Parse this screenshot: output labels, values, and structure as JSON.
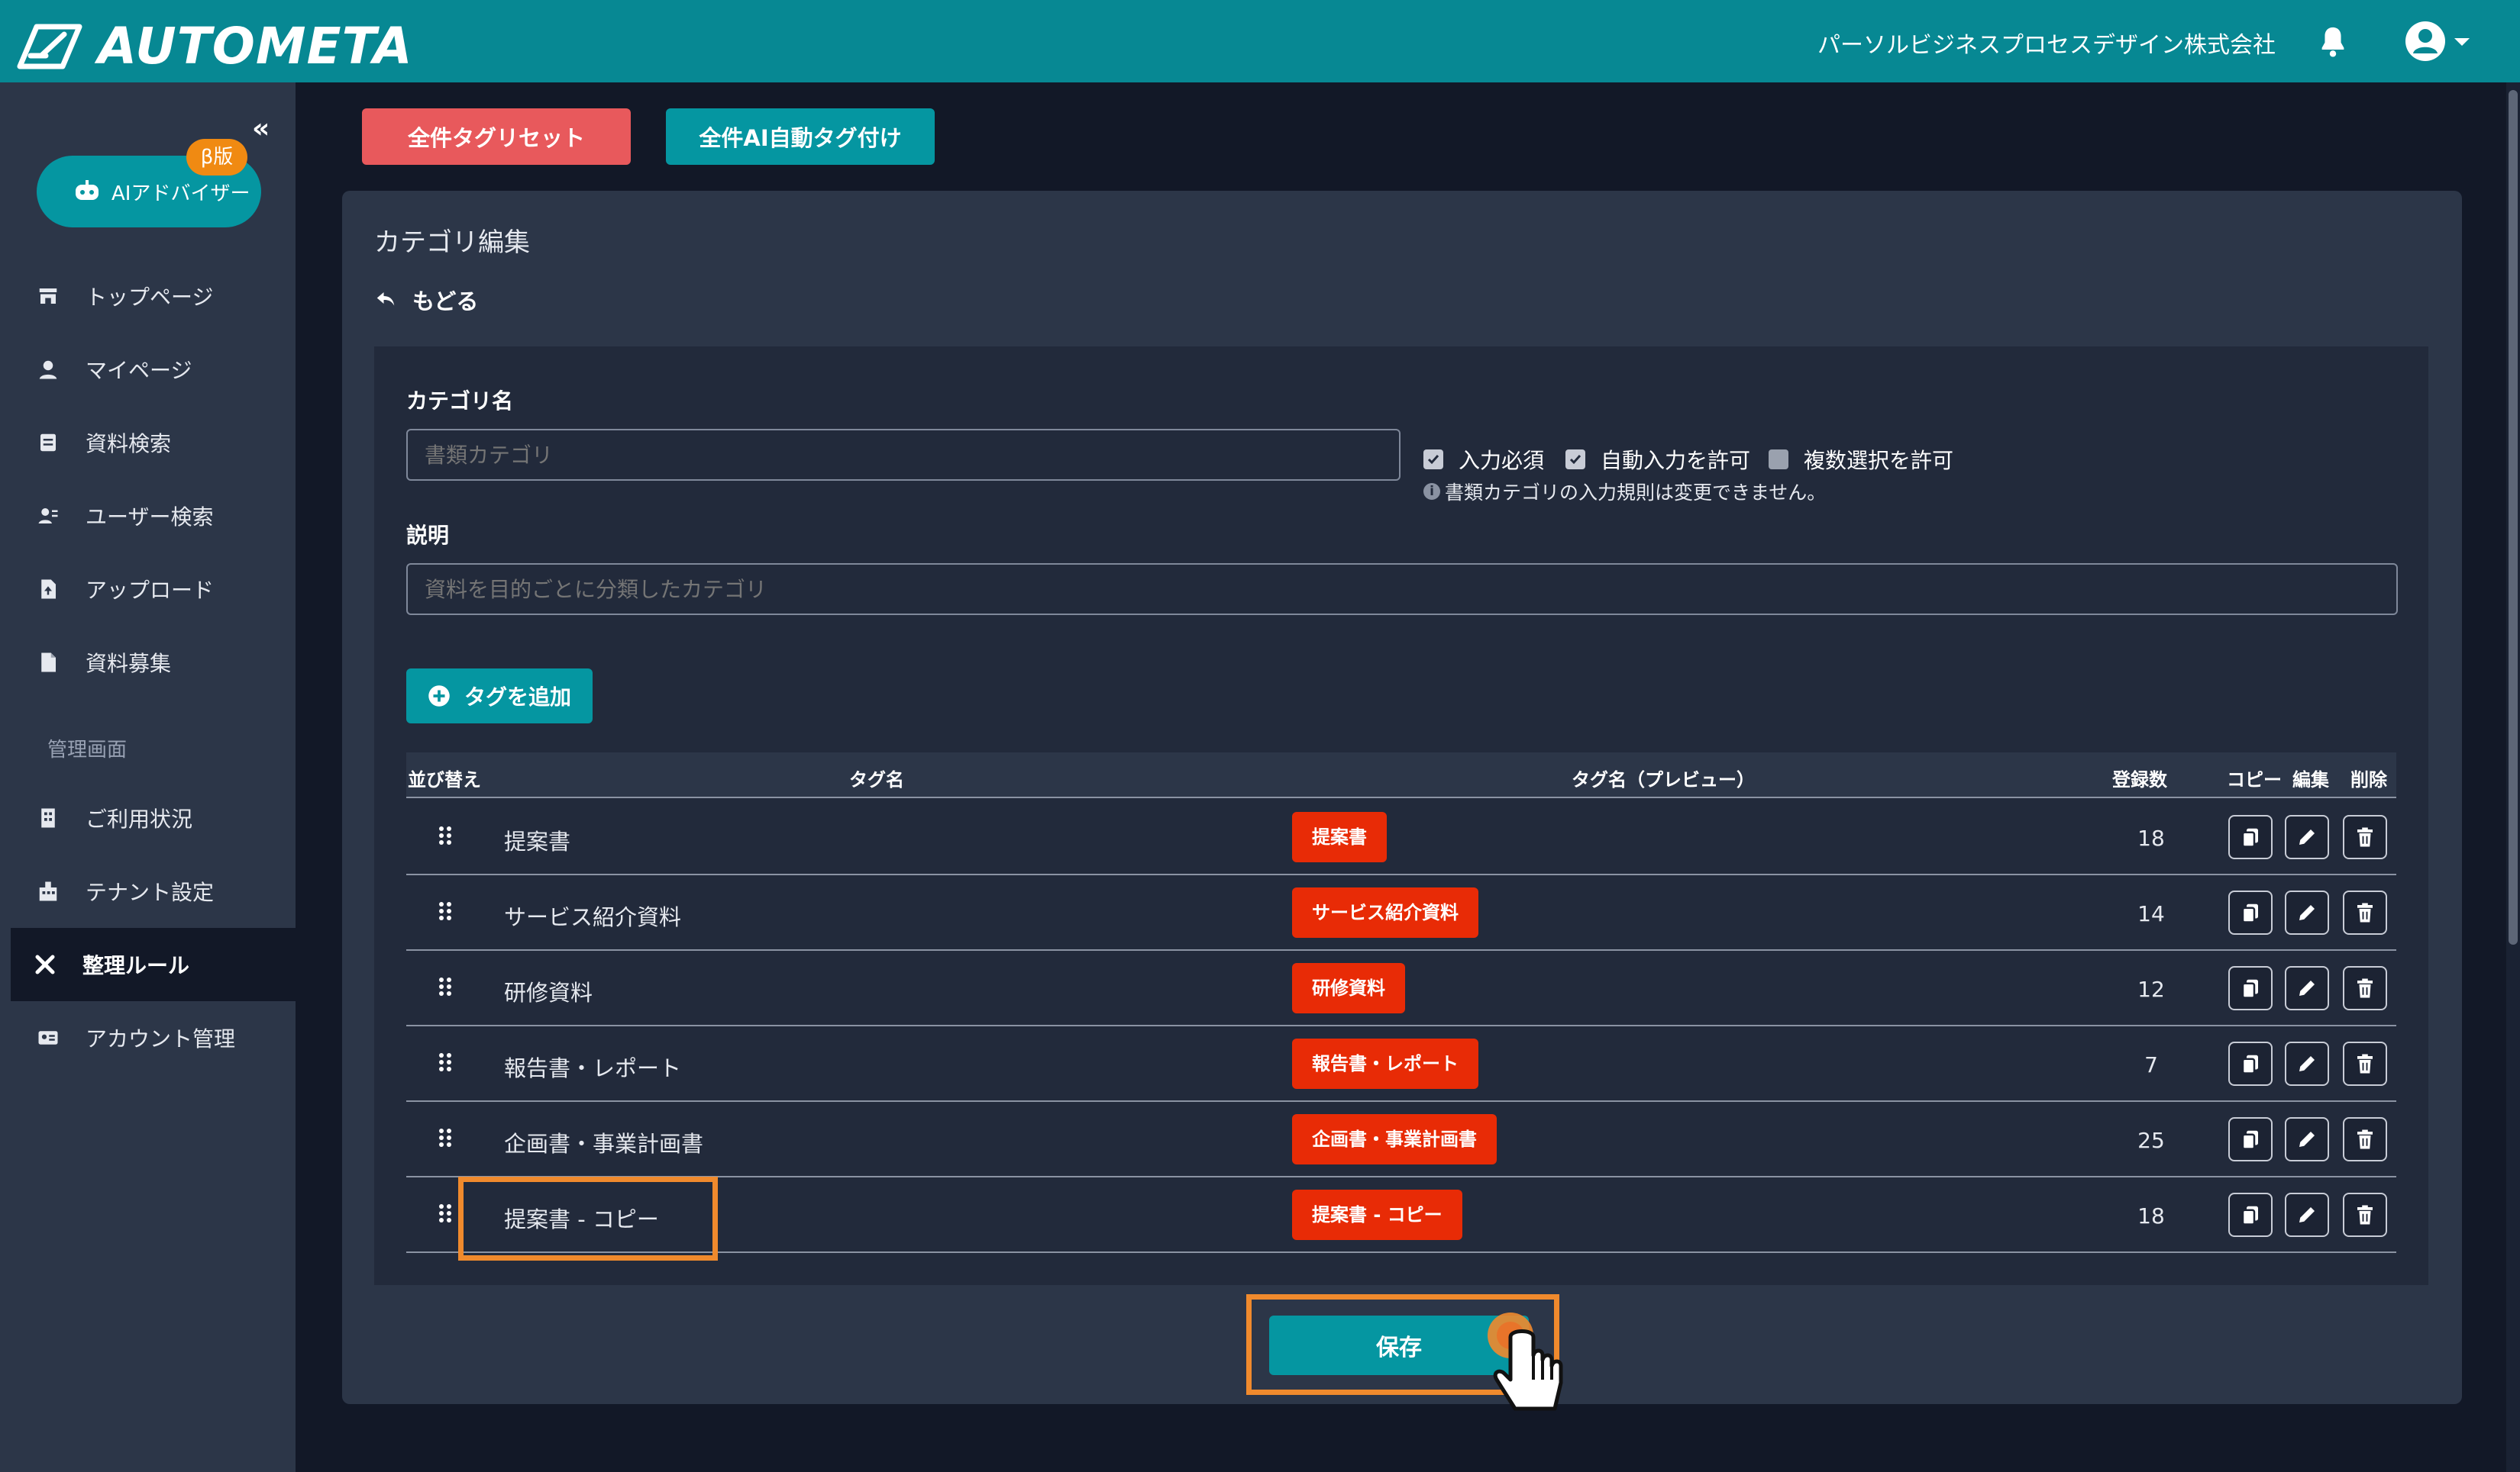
{
  "header": {
    "logo_text": "AUTOMETA",
    "company": "パーソルビジネスプロセスデザイン株式会社",
    "bell_icon": "bell-icon",
    "user_icon": "user-avatar-icon"
  },
  "sidebar": {
    "collapse_label": "«",
    "advisor_label": "AIアドバイザー",
    "beta_label": "β版",
    "section_label": "管理画面",
    "items": [
      {
        "label": "トップページ",
        "icon": "store-icon"
      },
      {
        "label": "マイページ",
        "icon": "user-icon"
      },
      {
        "label": "資料検索",
        "icon": "document-search-icon"
      },
      {
        "label": "ユーザー検索",
        "icon": "user-search-icon"
      },
      {
        "label": "アップロード",
        "icon": "upload-file-icon"
      },
      {
        "label": "資料募集",
        "icon": "file-icon"
      },
      {
        "label": "ご利用状況",
        "icon": "building-icon"
      },
      {
        "label": "テナント設定",
        "icon": "tenant-icon"
      },
      {
        "label": "整理ルール",
        "icon": "tools-icon",
        "active": true
      },
      {
        "label": "アカウント管理",
        "icon": "id-card-icon"
      }
    ]
  },
  "toolbar": {
    "reset_label": "全件タグリセット",
    "auto_tag_label": "全件AI自動タグ付け"
  },
  "main": {
    "title": "カテゴリ編集",
    "back_label": "もどる",
    "category_name_label": "カテゴリ名",
    "category_name_placeholder": "書類カテゴリ",
    "required_label": "入力必須",
    "auto_input_label": "自動入力を許可",
    "multi_select_label": "複数選択を許可",
    "required_checked": true,
    "auto_input_checked": true,
    "multi_select_checked": false,
    "note": "書類カテゴリの入力規則は変更できません。",
    "description_label": "説明",
    "description_placeholder": "資料を目的ごとに分類したカテゴリ",
    "add_tag_label": "タグを追加",
    "save_label": "保存"
  },
  "table": {
    "headers": {
      "sort": "並び替え",
      "tag_name": "タグ名",
      "preview": "タグ名（プレビュー）",
      "count": "登録数",
      "copy": "コピー",
      "edit": "編集",
      "delete": "削除"
    },
    "rows": [
      {
        "name": "提案書",
        "preview": "提案書",
        "count": "18"
      },
      {
        "name": "サービス紹介資料",
        "preview": "サービス紹介資料",
        "count": "14"
      },
      {
        "name": "研修資料",
        "preview": "研修資料",
        "count": "12"
      },
      {
        "name": "報告書・レポート",
        "preview": "報告書・レポート",
        "count": "7"
      },
      {
        "name": "企画書・事業計画書",
        "preview": "企画書・事業計画書",
        "count": "25"
      },
      {
        "name": "提案書 - コピー",
        "preview": "提案書 - コピー",
        "count": "18"
      }
    ]
  },
  "colors": {
    "header_bg": "#078893",
    "accent": "#0596a1",
    "danger_button": "#e8595c",
    "tag_badge": "#e82b06",
    "highlight": "#f08a2d"
  }
}
